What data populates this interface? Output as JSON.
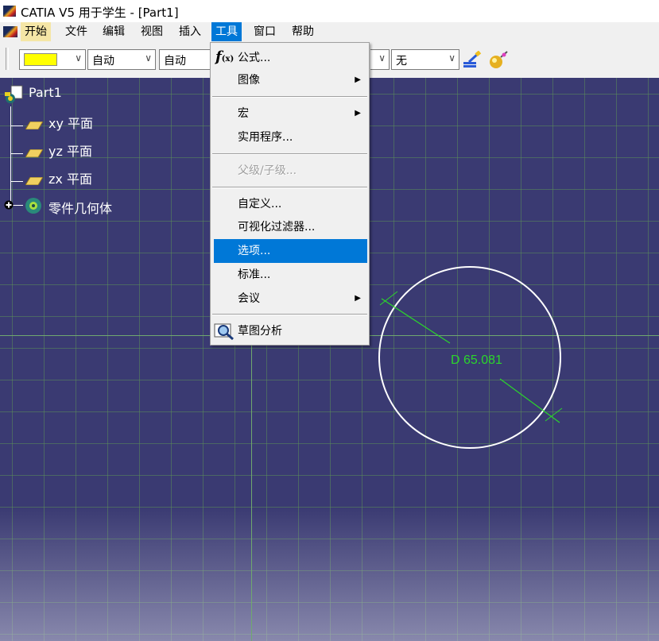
{
  "window": {
    "title": "CATIA V5 用于学生 - [Part1]"
  },
  "menubar": {
    "items": [
      "开始",
      "文件",
      "编辑",
      "视图",
      "插入",
      "工具",
      "窗口",
      "帮助"
    ]
  },
  "toolbar": {
    "color_value": "",
    "line_type": "自动",
    "line_weight": "自动",
    "layer": "无"
  },
  "tree": {
    "root": "Part1",
    "children": [
      "xy 平面",
      "yz 平面",
      "zx 平面",
      "零件几何体"
    ]
  },
  "tools_menu": {
    "items": [
      {
        "label": "公式...",
        "icon": "formula-fx-icon"
      },
      {
        "label": "图像",
        "submenu": true
      },
      {
        "label": "宏",
        "submenu": true
      },
      {
        "label": "实用程序..."
      },
      {
        "label": "父级/子级...",
        "disabled": true
      },
      {
        "label": "自定义..."
      },
      {
        "label": "可视化过滤器..."
      },
      {
        "label": "选项...",
        "highlighted": true
      },
      {
        "label": "标准..."
      },
      {
        "label": "会议",
        "submenu": true
      },
      {
        "label": "草图分析",
        "icon": "sketch-analysis-icon"
      }
    ]
  },
  "sketch": {
    "dimension_text": "D 65.081",
    "dimension_color": "#2bd62b",
    "circle_color": "#ffffff"
  },
  "colors": {
    "highlight": "#0078d7",
    "background": "#3a3a72",
    "swatch": "#ffff00"
  }
}
